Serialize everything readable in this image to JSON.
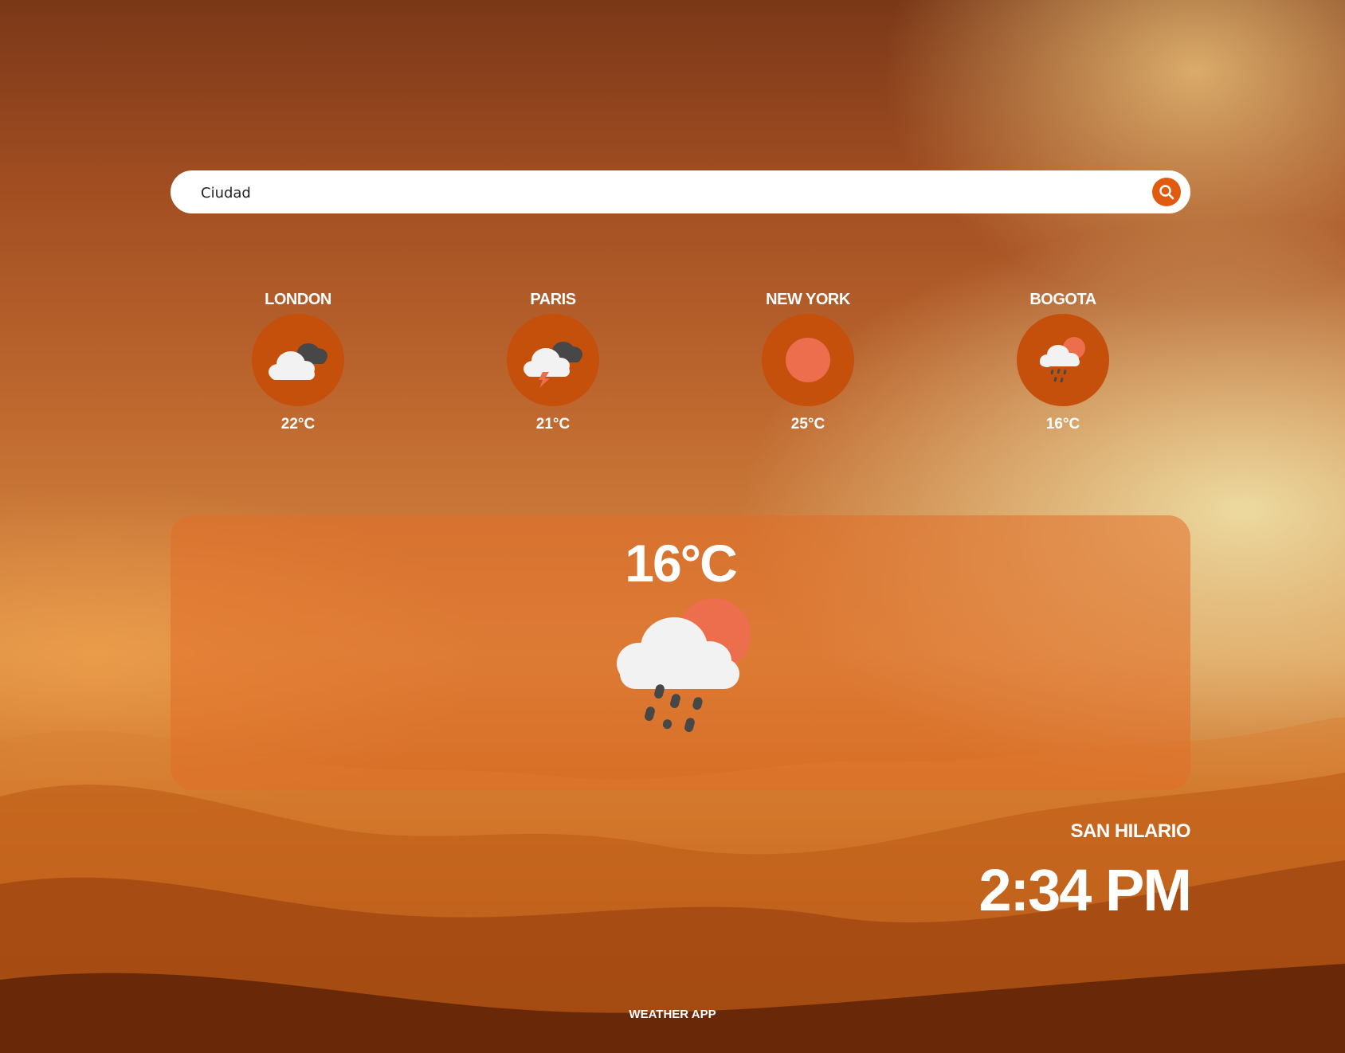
{
  "search": {
    "placeholder": "Ciudad",
    "button_icon": "search-icon"
  },
  "cities": [
    {
      "name": "London",
      "temp": "22°C",
      "icon": "cloudy-icon"
    },
    {
      "name": "Paris",
      "temp": "21°C",
      "icon": "thunderstorm-icon"
    },
    {
      "name": "New York",
      "temp": "25°C",
      "icon": "sun-icon"
    },
    {
      "name": "Bogota",
      "temp": "16°C",
      "icon": "sun-rain-icon"
    }
  ],
  "current": {
    "temp": "16°C",
    "icon": "sun-rain-icon"
  },
  "location": {
    "name": "San Hilario",
    "time": "2:34 PM"
  },
  "footer": {
    "label": "Weather App"
  },
  "colors": {
    "accent": "#e05a10",
    "icon_circle": "#c4500c",
    "sun": "#ec6e4c",
    "cloud": "#f2f2f2",
    "dark_cloud": "#474747"
  }
}
